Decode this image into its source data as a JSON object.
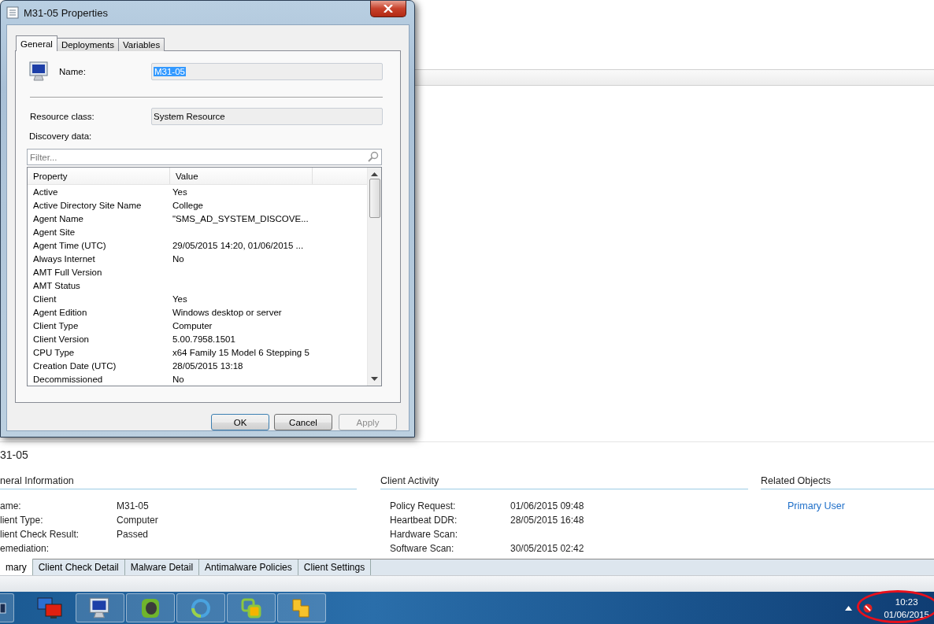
{
  "console": {
    "title": "31-05",
    "sections": [
      {
        "kind": "fields",
        "heading": "neral Information",
        "rows": [
          {
            "label": "ame:",
            "value": "M31-05"
          },
          {
            "label": "lient Type:",
            "value": "Computer"
          },
          {
            "label": "lient Check Result:",
            "value": "Passed"
          },
          {
            "label": "emediation:",
            "value": ""
          }
        ]
      },
      {
        "kind": "fields",
        "heading": "Client Activity",
        "rows": [
          {
            "label": "Policy Request:",
            "value": "01/06/2015 09:48"
          },
          {
            "label": "Heartbeat DDR:",
            "value": "28/05/2015 16:48"
          },
          {
            "label": "Hardware Scan:",
            "value": ""
          },
          {
            "label": "Software Scan:",
            "value": "30/05/2015 02:42"
          }
        ]
      },
      {
        "kind": "links",
        "heading": "Related Objects",
        "links": [
          "Primary User"
        ]
      }
    ],
    "tabs": [
      {
        "label": "mary",
        "selected": true
      },
      {
        "label": "Client Check Detail",
        "selected": false
      },
      {
        "label": "Malware Detail",
        "selected": false
      },
      {
        "label": "Antimalware Policies",
        "selected": false
      },
      {
        "label": "Client Settings",
        "selected": false
      }
    ]
  },
  "dialog": {
    "title": "M31-05 Properties",
    "tabs": [
      {
        "label": "General",
        "selected": true
      },
      {
        "label": "Deployments",
        "selected": false
      },
      {
        "label": "Variables",
        "selected": false
      }
    ],
    "name_label": "Name:",
    "name_value": "M31-05",
    "name_value_selected": true,
    "resource_class_label": "Resource class:",
    "resource_class_value": "System Resource",
    "discovery_label": "Discovery data:",
    "filter_placeholder": "Filter...",
    "columns": [
      "Property",
      "Value"
    ],
    "rows": [
      {
        "property": "Active",
        "value": "Yes"
      },
      {
        "property": "Active Directory Site Name",
        "value": "College"
      },
      {
        "property": "Agent Name",
        "value": "\"SMS_AD_SYSTEM_DISCOVE..."
      },
      {
        "property": "Agent Site",
        "value": ""
      },
      {
        "property": "Agent Time (UTC)",
        "value": "29/05/2015 14:20, 01/06/2015 ..."
      },
      {
        "property": "Always Internet",
        "value": "No"
      },
      {
        "property": "AMT Full Version",
        "value": ""
      },
      {
        "property": "AMT Status",
        "value": ""
      },
      {
        "property": "Client",
        "value": "Yes"
      },
      {
        "property": "Agent Edition",
        "value": "Windows desktop or server"
      },
      {
        "property": "Client Type",
        "value": "Computer"
      },
      {
        "property": "Client Version",
        "value": "5.00.7958.1501"
      },
      {
        "property": "CPU Type",
        "value": "x64 Family 15 Model 6 Stepping 5"
      },
      {
        "property": "Creation Date (UTC)",
        "value": "28/05/2015 13:18"
      },
      {
        "property": "Decommissioned",
        "value": "No"
      }
    ],
    "buttons": [
      {
        "label": "OK",
        "disabled": false,
        "default": true
      },
      {
        "label": "Cancel",
        "disabled": false,
        "default": false
      },
      {
        "label": "Apply",
        "disabled": true,
        "default": false
      }
    ]
  },
  "taskbar": {
    "time": "10:23",
    "date": "01/06/2015"
  }
}
